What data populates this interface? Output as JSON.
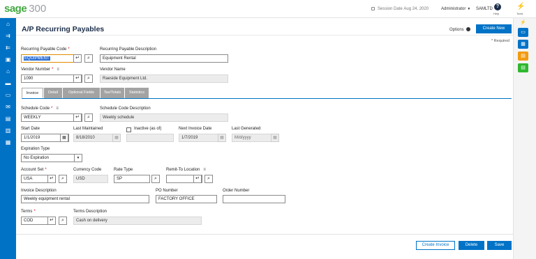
{
  "app": {
    "brand": "sage",
    "version": "300"
  },
  "topbar": {
    "session_label": "Session Date",
    "session_date": "Aug 24, 2020",
    "user": "Administrator",
    "company": "SAMLTD",
    "help_label": "Help",
    "tools_label": "Tools"
  },
  "page": {
    "title": "A/P Recurring Payables",
    "options_label": "Options",
    "create_new_label": "Create New",
    "required_note": "* Required"
  },
  "form": {
    "recurring_code_label": "Recurring Payable Code",
    "recurring_code_value": "EQUIPMENT",
    "recurring_desc_label": "Recurring Payable Description",
    "recurring_desc_value": "Equipment Rental",
    "vendor_number_label": "Vendor Number",
    "vendor_number_value": "1090",
    "vendor_name_label": "Vendor Name",
    "vendor_name_value": "Raeside Equipment Ltd."
  },
  "tabs": [
    {
      "label": "Invoice"
    },
    {
      "label": "Detail"
    },
    {
      "label": "Optional Fields"
    },
    {
      "label": "Tax/Totals"
    },
    {
      "label": "Statistics"
    }
  ],
  "invoice": {
    "schedule_code_label": "Schedule Code",
    "schedule_code_value": "WEEKLY",
    "schedule_desc_label": "Schedule Code Description",
    "schedule_desc_value": "Weekly schedule",
    "start_date_label": "Start Date",
    "start_date_value": "1/1/2019",
    "last_maintained_label": "Last Maintained",
    "last_maintained_value": "8/18/2010",
    "inactive_label": "Inactive (as of)",
    "next_invoice_label": "Next Invoice Date",
    "next_invoice_value": "1/7/2019",
    "last_generated_label": "Last Generated",
    "last_generated_placeholder": "M/d/yyyy",
    "expiration_type_label": "Expiration Type",
    "expiration_type_value": "No Expiration",
    "account_set_label": "Account Set",
    "account_set_value": "USA",
    "currency_code_label": "Currency Code",
    "currency_code_value": "USD",
    "rate_type_label": "Rate Type",
    "rate_type_value": "SP",
    "remit_to_label": "Remit-To Location",
    "remit_to_value": "",
    "invoice_desc_label": "Invoice Description",
    "invoice_desc_value": "Weekly equipment rental",
    "po_number_label": "PO Number",
    "po_number_value": "FACTORY OFFICE",
    "order_number_label": "Order Number",
    "order_number_value": "",
    "terms_label": "Terms",
    "terms_value": "COD",
    "terms_desc_label": "Terms Description",
    "terms_desc_value": "Cash on delivery"
  },
  "actions": {
    "create_invoice": "Create Invoice",
    "delete": "Delete",
    "save": "Save"
  },
  "colors": {
    "brand_green": "#41a940",
    "primary_blue": "#0073c7",
    "nav_blue": "#0072c6",
    "title_navy": "#1c2f4b",
    "rail_orange": "#f29b0f",
    "rail_green": "#2eb82e"
  }
}
